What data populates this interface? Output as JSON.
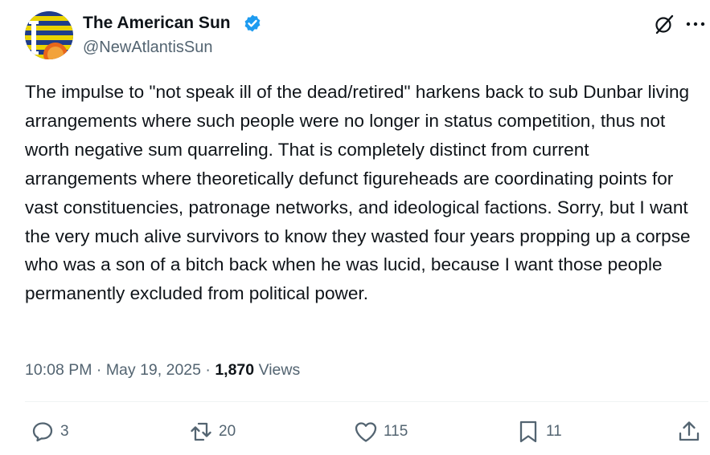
{
  "author": {
    "display_name": "The American Sun",
    "handle": "@NewAtlantisSun",
    "verified": true,
    "avatar_icon": "striped-flag-sun-avatar-icon"
  },
  "tweet": {
    "text": "The impulse to \"not speak ill of the dead/retired\" harkens back to sub Dunbar living arrangements where such people were no longer in status competition, thus not worth negative sum quarreling. That is completely distinct from current arrangements where theoretically defunct figureheads are coordinating points for vast constituencies, patronage networks, and ideological factions. Sorry, but I want the very much alive survivors to know they wasted four years propping up a corpse who was a son of a bitch back when he was lucid, because I want those people permanently excluded from political power.",
    "time": "10:08 PM",
    "separator": "·",
    "date": "May 19, 2025",
    "views_count": "1,870",
    "views_label": "Views"
  },
  "actions": {
    "reply_count": "3",
    "repost_count": "20",
    "like_count": "115",
    "bookmark_count": "11"
  },
  "icons": {
    "grok": "grok-icon",
    "more": "more-dots-icon",
    "reply": "reply-icon",
    "repost": "repost-icon",
    "like": "heart-icon",
    "bookmark": "bookmark-icon",
    "share": "share-icon"
  },
  "colors": {
    "text_primary": "#0f1419",
    "text_secondary": "#536471",
    "verified_blue": "#1d9bf0",
    "divider": "#eff3f4"
  }
}
